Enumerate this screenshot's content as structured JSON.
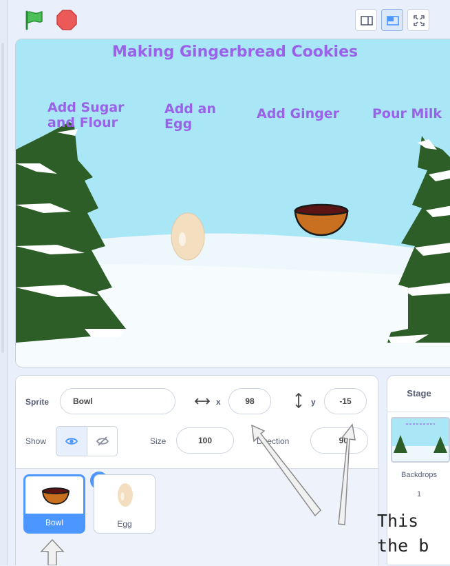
{
  "toolbar": {
    "green_flag_icon": "green-flag-icon",
    "stop_icon": "stop-sign-icon",
    "view_buttons": [
      "small-stage-icon",
      "normal-stage-icon",
      "fullscreen-icon"
    ],
    "colors": {
      "flag": "#3bb54a",
      "stop": "#ec5959",
      "accent": "#4c97ff"
    }
  },
  "stage": {
    "title": "Making Gingerbread Cookies",
    "labels": [
      "Add Sugar\nand Flour",
      "Add an\nEgg",
      "Add Ginger",
      "Pour Milk"
    ],
    "sprites": [
      "Egg",
      "Bowl"
    ]
  },
  "sprite_info": {
    "sprite_label": "Sprite",
    "sprite_name": "Bowl",
    "x_label": "x",
    "x_value": "98",
    "y_label": "y",
    "y_value": "-15",
    "show_label": "Show",
    "size_label": "Size",
    "size_value": "100",
    "direction_label": "Direction",
    "direction_value": "90"
  },
  "sprites_list": [
    {
      "name": "Bowl",
      "selected": true
    },
    {
      "name": "Egg",
      "selected": false
    }
  ],
  "stage_pane": {
    "title": "Stage",
    "backdrops_label": "Backdrops",
    "backdrops_count": "1"
  },
  "annotation": {
    "line1": "This",
    "line2": "the b"
  }
}
